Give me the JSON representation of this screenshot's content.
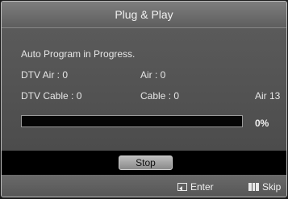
{
  "dialog": {
    "title": "Plug & Play"
  },
  "status": {
    "message": "Auto Program in Progress.",
    "dtv_air": "DTV Air : 0",
    "air": "Air : 0",
    "dtv_cable": "DTV Cable : 0",
    "cable": "Cable : 0",
    "current_channel": "Air 13"
  },
  "progress": {
    "value_fraction": 0.0,
    "label": "0%"
  },
  "buttons": {
    "stop_label": "Stop"
  },
  "footer": {
    "enter_label": "Enter",
    "skip_label": "Skip"
  },
  "colors": {
    "background": "#595959",
    "band": "#000000",
    "button": "#a8a8a8"
  }
}
